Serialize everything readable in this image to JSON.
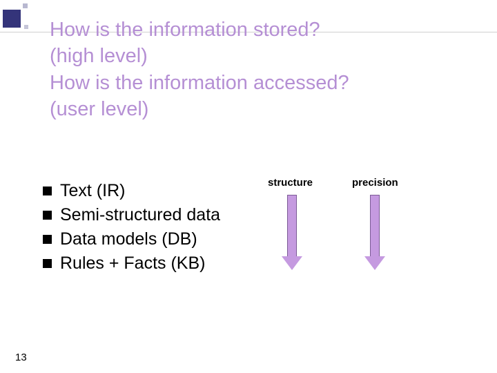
{
  "title": {
    "line1": "How is the information stored?",
    "line2": "(high level)",
    "line3": "How is the information accessed?",
    "line4": "(user level)"
  },
  "bullets": [
    "Text  (IR)",
    "Semi-structured data",
    "Data models (DB)",
    "Rules + Facts (KB)"
  ],
  "columns": {
    "left_label": "structure",
    "right_label": "precision"
  },
  "page_number": "13"
}
